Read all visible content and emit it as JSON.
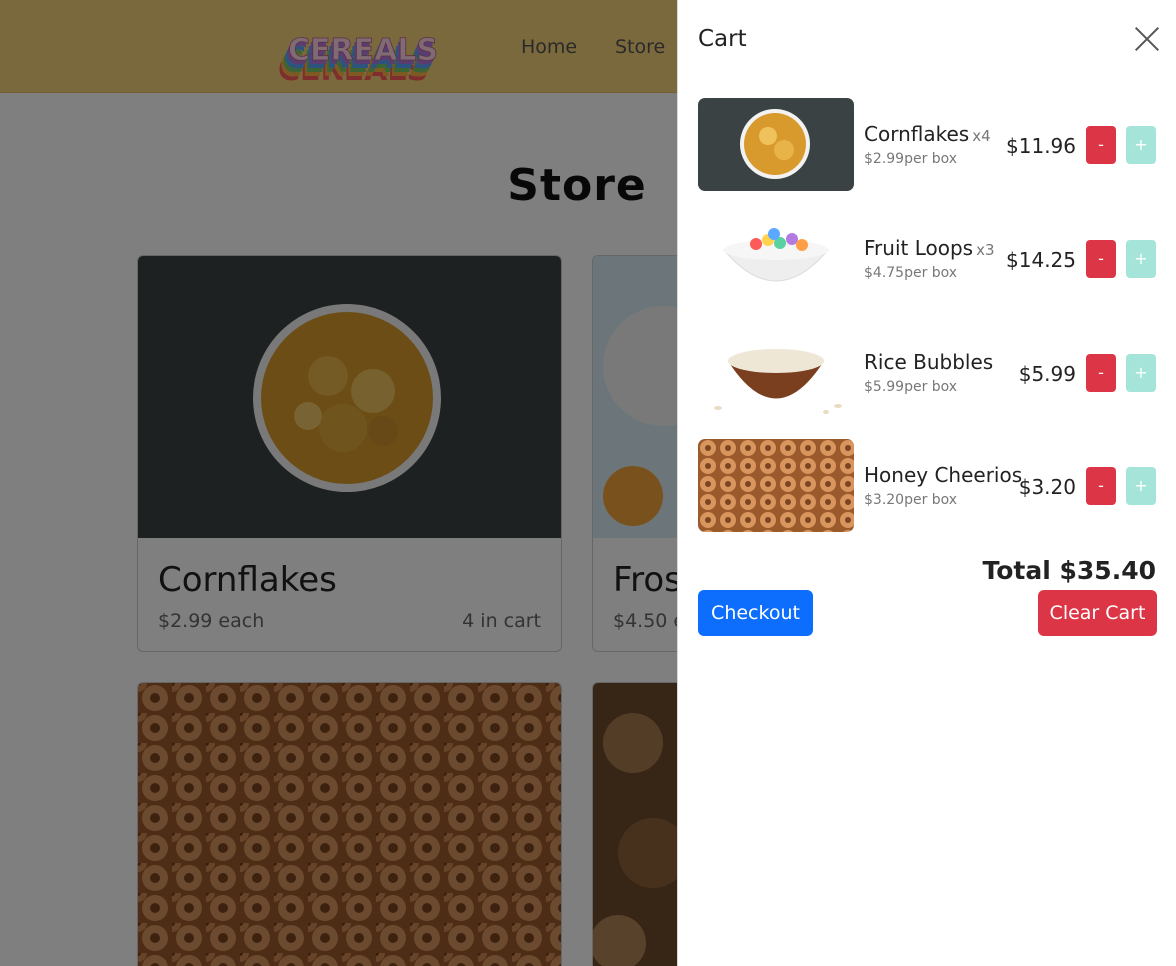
{
  "nav": {
    "logo_text": "CEREALS",
    "links": [
      "Home",
      "Store"
    ]
  },
  "store": {
    "title": "Store",
    "cards": [
      {
        "name": "Cornflakes",
        "price": "$2.99 each",
        "in_cart": "4 in cart"
      },
      {
        "name": "Fros",
        "price": "$4.50 e",
        "in_cart": ""
      }
    ]
  },
  "cart": {
    "title": "Cart",
    "items": [
      {
        "name": "Cornflakes",
        "qty": "x4",
        "unit": "$2.99per box",
        "total": "$11.96"
      },
      {
        "name": "Fruit Loops",
        "qty": "x3",
        "unit": "$4.75per box",
        "total": "$14.25"
      },
      {
        "name": "Rice Bubbles",
        "qty": "",
        "unit": "$5.99per box",
        "total": "$5.99"
      },
      {
        "name": "Honey Cheerios",
        "qty": "",
        "unit": "$3.20per box",
        "total": "$3.20"
      }
    ],
    "minus_label": "-",
    "plus_label": "+",
    "total": "Total $35.40",
    "checkout_label": "Checkout",
    "clear_label": "Clear Cart"
  },
  "colors": {
    "navbar": "#f5d27a",
    "checkout": "#0d6efd",
    "danger": "#dc3545",
    "plus": "#a4e4d9"
  }
}
